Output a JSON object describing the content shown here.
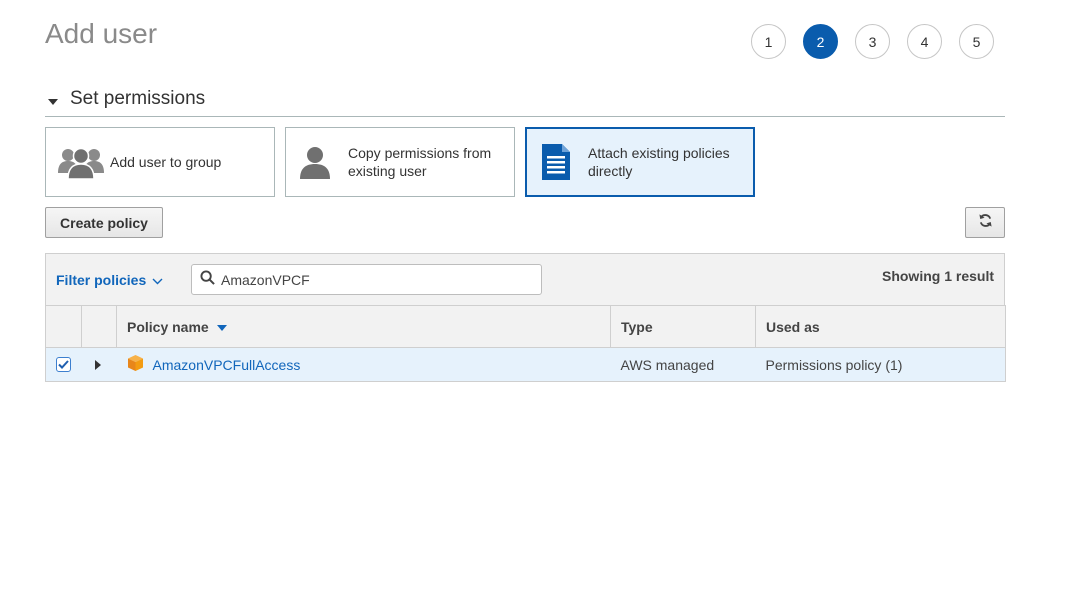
{
  "page": {
    "title": "Add user"
  },
  "steps": [
    "1",
    "2",
    "3",
    "4",
    "5"
  ],
  "active_step": "2",
  "section": {
    "title": "Set permissions"
  },
  "tiles": [
    {
      "label": "Add user to group",
      "icon": "users-group-icon",
      "selected": false
    },
    {
      "label": "Copy permissions from existing user",
      "icon": "user-icon",
      "selected": false
    },
    {
      "label": "Attach existing policies directly",
      "icon": "document-icon",
      "selected": true
    }
  ],
  "toolbar": {
    "create_policy_label": "Create policy",
    "refresh_icon": "refresh-icon"
  },
  "filter": {
    "label": "Filter policies",
    "search_value": "AmazonVPCF",
    "showing_text": "Showing 1 result"
  },
  "table": {
    "columns": [
      "",
      "",
      "Policy name",
      "Type",
      "Used as"
    ],
    "sorted_column": "Policy name",
    "rows": [
      {
        "checked": true,
        "policy_name": "AmazonVPCFullAccess",
        "type": "AWS managed",
        "used_as": "Permissions policy (1)"
      }
    ]
  },
  "colors": {
    "accent": "#0a5cad",
    "link": "#1166bb",
    "selected_bg": "#e6f2fc",
    "policy_icon": "#f39c12"
  }
}
